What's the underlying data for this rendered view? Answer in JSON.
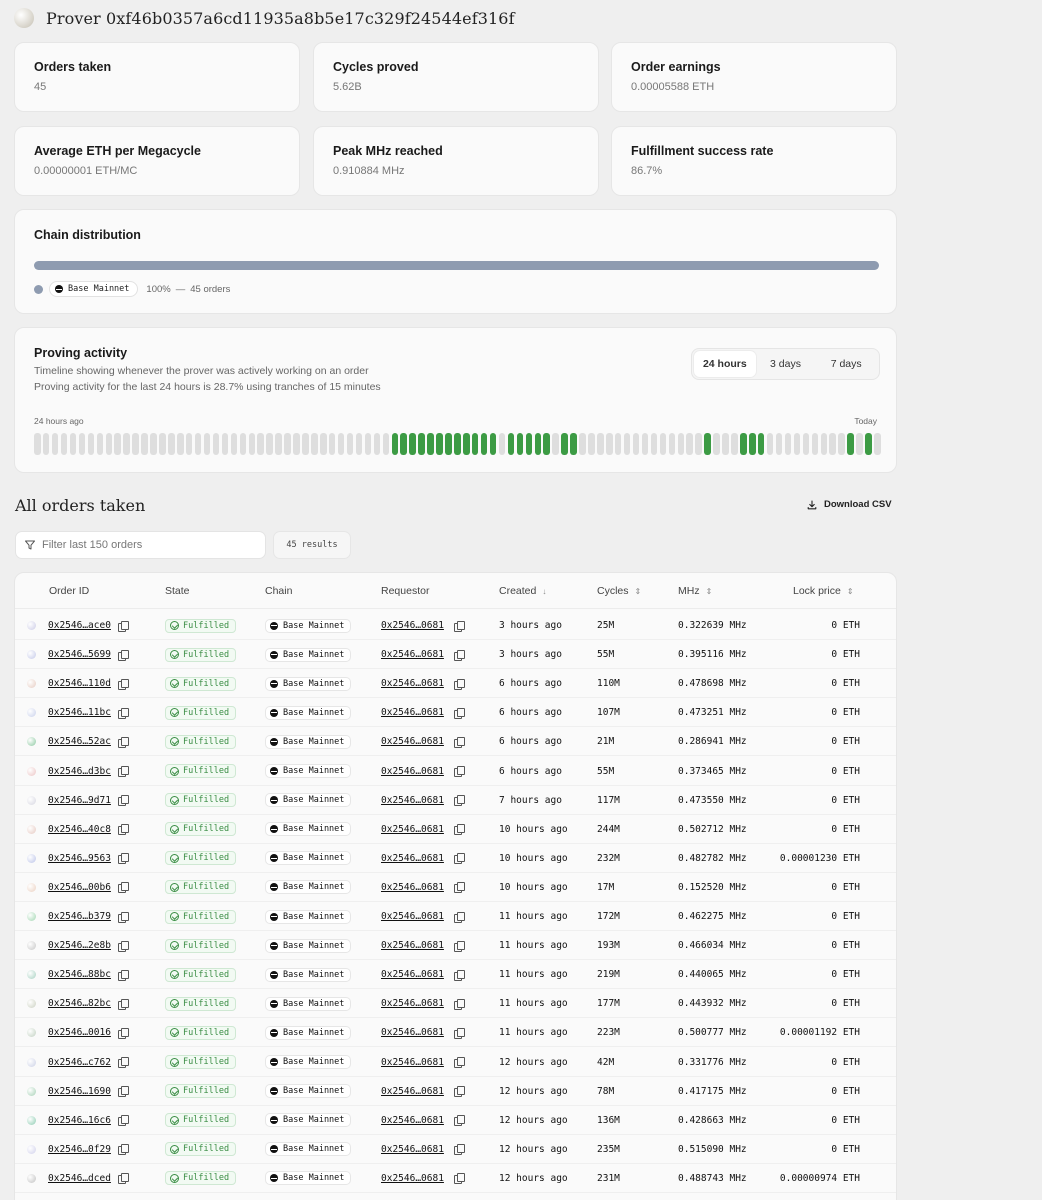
{
  "header": {
    "title": "Prover 0xf46b0357a6cd11935a8b5e17c329f24544ef316f"
  },
  "stats": [
    {
      "label": "Orders taken",
      "value": "45"
    },
    {
      "label": "Cycles proved",
      "value": "5.62B"
    },
    {
      "label": "Order earnings",
      "value": "0.00005588 ETH"
    },
    {
      "label": "Average ETH per Megacycle",
      "value": "0.00000001 ETH/MC"
    },
    {
      "label": "Peak MHz reached",
      "value": "0.910884 MHz"
    },
    {
      "label": "Fulfillment success rate",
      "value": "86.7%"
    }
  ],
  "chain_distribution": {
    "title": "Chain distribution",
    "bar_color": "#8e9bb0",
    "chain": "Base Mainnet",
    "percent": "100%",
    "separator": "—",
    "orders": "45 orders",
    "share": 1.0
  },
  "proving_activity": {
    "title": "Proving activity",
    "subtitle1": "Timeline showing whenever the prover was actively working on an order",
    "subtitle2": "Proving activity for the last 24 hours is 28.7% using tranches of 15 minutes",
    "tabs": [
      "24 hours",
      "3 days",
      "7 days"
    ],
    "active_tab": "24 hours",
    "left_label": "24 hours ago",
    "right_label": "Today",
    "active_color": "#3c9b44",
    "inactive_color": "#dedede",
    "slots": [
      0,
      0,
      0,
      0,
      0,
      0,
      0,
      0,
      0,
      0,
      0,
      0,
      0,
      0,
      0,
      0,
      0,
      0,
      0,
      0,
      0,
      0,
      0,
      0,
      0,
      0,
      0,
      0,
      0,
      0,
      0,
      0,
      0,
      0,
      0,
      0,
      0,
      0,
      0,
      0,
      1,
      1,
      1,
      1,
      1,
      1,
      1,
      1,
      1,
      1,
      1,
      1,
      0,
      1,
      1,
      1,
      1,
      1,
      0,
      1,
      1,
      0,
      0,
      0,
      0,
      0,
      0,
      0,
      0,
      0,
      0,
      0,
      0,
      0,
      0,
      1,
      0,
      0,
      0,
      1,
      1,
      1,
      0,
      0,
      0,
      0,
      0,
      0,
      0,
      0,
      0,
      1,
      0,
      1,
      0
    ]
  },
  "orders": {
    "title": "All orders taken",
    "download_label": "Download CSV",
    "filter_placeholder": "Filter last 150 orders",
    "results": "45 results",
    "columns": {
      "order_id": "Order ID",
      "state": "State",
      "chain": "Chain",
      "requestor": "Requestor",
      "created": "Created",
      "cycles": "Cycles",
      "mhz": "MHz",
      "lock_price": "Lock price"
    },
    "rows": [
      {
        "id": "0x2546…ace0",
        "state": "Fulfilled",
        "chain": "Base Mainnet",
        "requestor": "0x2546…0681",
        "created": "3 hours ago",
        "cycles": "25M",
        "mhz": "0.322639 MHz",
        "price": "0 ETH",
        "dot": "#d8d8ec"
      },
      {
        "id": "0x2546…5699",
        "state": "Fulfilled",
        "chain": "Base Mainnet",
        "requestor": "0x2546…0681",
        "created": "3 hours ago",
        "cycles": "55M",
        "mhz": "0.395116 MHz",
        "price": "0 ETH",
        "dot": "#d2d6ee"
      },
      {
        "id": "0x2546…110d",
        "state": "Fulfilled",
        "chain": "Base Mainnet",
        "requestor": "0x2546…0681",
        "created": "6 hours ago",
        "cycles": "110M",
        "mhz": "0.478698 MHz",
        "price": "0 ETH",
        "dot": "#ecd8d0"
      },
      {
        "id": "0x2546…11bc",
        "state": "Fulfilled",
        "chain": "Base Mainnet",
        "requestor": "0x2546…0681",
        "created": "6 hours ago",
        "cycles": "107M",
        "mhz": "0.473251 MHz",
        "price": "0 ETH",
        "dot": "#d6dcf0"
      },
      {
        "id": "0x2546…52ac",
        "state": "Fulfilled",
        "chain": "Base Mainnet",
        "requestor": "0x2546…0681",
        "created": "6 hours ago",
        "cycles": "21M",
        "mhz": "0.286941 MHz",
        "price": "0 ETH",
        "dot": "#a8d6b8"
      },
      {
        "id": "0x2546…d3bc",
        "state": "Fulfilled",
        "chain": "Base Mainnet",
        "requestor": "0x2546…0681",
        "created": "6 hours ago",
        "cycles": "55M",
        "mhz": "0.373465 MHz",
        "price": "0 ETH",
        "dot": "#f0d2d2"
      },
      {
        "id": "0x2546…9d71",
        "state": "Fulfilled",
        "chain": "Base Mainnet",
        "requestor": "0x2546…0681",
        "created": "7 hours ago",
        "cycles": "117M",
        "mhz": "0.473550 MHz",
        "price": "0 ETH",
        "dot": "#e0e0e8"
      },
      {
        "id": "0x2546…40c8",
        "state": "Fulfilled",
        "chain": "Base Mainnet",
        "requestor": "0x2546…0681",
        "created": "10 hours ago",
        "cycles": "244M",
        "mhz": "0.502712 MHz",
        "price": "0 ETH",
        "dot": "#ecd6d0"
      },
      {
        "id": "0x2546…9563",
        "state": "Fulfilled",
        "chain": "Base Mainnet",
        "requestor": "0x2546…0681",
        "created": "10 hours ago",
        "cycles": "232M",
        "mhz": "0.482782 MHz",
        "price": "0.00001230 ETH",
        "dot": "#ccd2ee"
      },
      {
        "id": "0x2546…00b6",
        "state": "Fulfilled",
        "chain": "Base Mainnet",
        "requestor": "0x2546…0681",
        "created": "10 hours ago",
        "cycles": "17M",
        "mhz": "0.152520 MHz",
        "price": "0 ETH",
        "dot": "#f0dcd0"
      },
      {
        "id": "0x2546…b379",
        "state": "Fulfilled",
        "chain": "Base Mainnet",
        "requestor": "0x2546…0681",
        "created": "11 hours ago",
        "cycles": "172M",
        "mhz": "0.462275 MHz",
        "price": "0 ETH",
        "dot": "#b8e0c4"
      },
      {
        "id": "0x2546…2e8b",
        "state": "Fulfilled",
        "chain": "Base Mainnet",
        "requestor": "0x2546…0681",
        "created": "11 hours ago",
        "cycles": "193M",
        "mhz": "0.466034 MHz",
        "price": "0 ETH",
        "dot": "#d4d4d4"
      },
      {
        "id": "0x2546…88bc",
        "state": "Fulfilled",
        "chain": "Base Mainnet",
        "requestor": "0x2546…0681",
        "created": "11 hours ago",
        "cycles": "219M",
        "mhz": "0.440065 MHz",
        "price": "0 ETH",
        "dot": "#bcdcd0"
      },
      {
        "id": "0x2546…82bc",
        "state": "Fulfilled",
        "chain": "Base Mainnet",
        "requestor": "0x2546…0681",
        "created": "11 hours ago",
        "cycles": "177M",
        "mhz": "0.443932 MHz",
        "price": "0 ETH",
        "dot": "#d8dcd0"
      },
      {
        "id": "0x2546…0016",
        "state": "Fulfilled",
        "chain": "Base Mainnet",
        "requestor": "0x2546…0681",
        "created": "11 hours ago",
        "cycles": "223M",
        "mhz": "0.500777 MHz",
        "price": "0.00001192 ETH",
        "dot": "#d0dcd0"
      },
      {
        "id": "0x2546…c762",
        "state": "Fulfilled",
        "chain": "Base Mainnet",
        "requestor": "0x2546…0681",
        "created": "12 hours ago",
        "cycles": "42M",
        "mhz": "0.331776 MHz",
        "price": "0 ETH",
        "dot": "#d8dcec"
      },
      {
        "id": "0x2546…1690",
        "state": "Fulfilled",
        "chain": "Base Mainnet",
        "requestor": "0x2546…0681",
        "created": "12 hours ago",
        "cycles": "78M",
        "mhz": "0.417175 MHz",
        "price": "0 ETH",
        "dot": "#bcdcc8"
      },
      {
        "id": "0x2546…16c6",
        "state": "Fulfilled",
        "chain": "Base Mainnet",
        "requestor": "0x2546…0681",
        "created": "12 hours ago",
        "cycles": "136M",
        "mhz": "0.428663 MHz",
        "price": "0 ETH",
        "dot": "#a8d8c4"
      },
      {
        "id": "0x2546…0f29",
        "state": "Fulfilled",
        "chain": "Base Mainnet",
        "requestor": "0x2546…0681",
        "created": "12 hours ago",
        "cycles": "235M",
        "mhz": "0.515090 MHz",
        "price": "0 ETH",
        "dot": "#dcdcf0"
      },
      {
        "id": "0x2546…dced",
        "state": "Fulfilled",
        "chain": "Base Mainnet",
        "requestor": "0x2546…0681",
        "created": "12 hours ago",
        "cycles": "231M",
        "mhz": "0.488743 MHz",
        "price": "0.00000974 ETH",
        "dot": "#d0d0d0"
      }
    ]
  }
}
